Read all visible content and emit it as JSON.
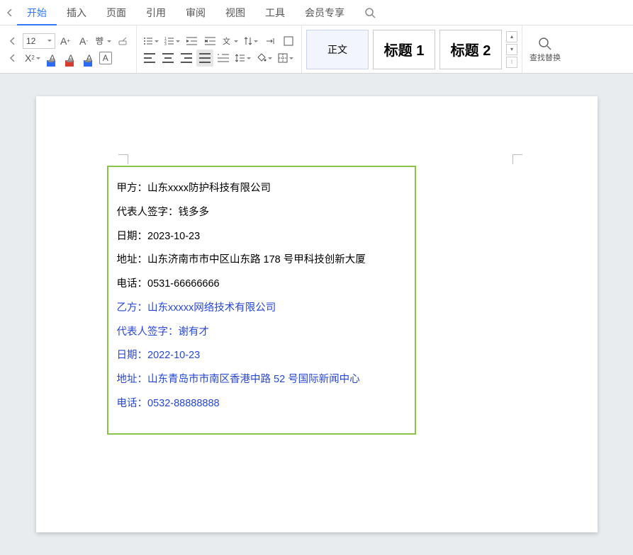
{
  "menu": {
    "items": [
      "开始",
      "插入",
      "页面",
      "引用",
      "审阅",
      "视图",
      "工具",
      "会员专享"
    ],
    "active_index": 0
  },
  "toolbar": {
    "font_size": "12",
    "styles": [
      "正文",
      "标题 1",
      "标题 2"
    ],
    "find_label": "查找替换"
  },
  "document": {
    "party_a": {
      "name_line": "甲方：山东xxxx防护科技有限公司",
      "sign_line": "代表人签字：钱多多",
      "date_line": "日期：2023-10-23",
      "addr_line": "地址：山东济南市市中区山东路 178 号甲科技创新大厦",
      "tel_line": "电话：0531-66666666"
    },
    "party_b": {
      "name_line": "乙方：山东xxxxx网络技术有限公司",
      "sign_line": "代表人签字：谢有才",
      "date_line": "日期：2022-10-23",
      "addr_line": "地址：山东青岛市市南区香港中路 52 号国际新闻中心",
      "tel_line": "电话：0532-88888888"
    }
  }
}
